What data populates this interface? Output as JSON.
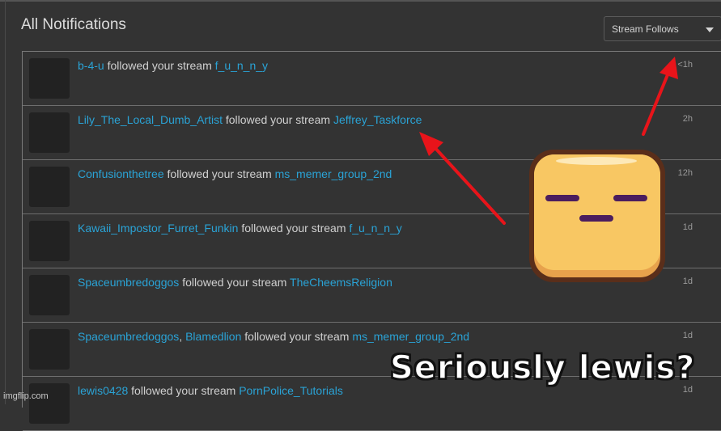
{
  "header": {
    "title": "All Notifications",
    "filter": {
      "selected": "Stream Follows"
    }
  },
  "colors": {
    "background": "#333333",
    "link": "#2aa3d6",
    "text": "#d0d0d0",
    "time": "#9a9a9a",
    "arrow": "#e8141a",
    "face": "#f8c763",
    "face_outline": "#5a2e1a",
    "face_features": "#4b1d5e"
  },
  "notifications": [
    {
      "users": [
        "b-4-u"
      ],
      "action": "followed your stream",
      "stream": "f_u_n_n_y",
      "time": "<1h"
    },
    {
      "users": [
        "Lily_The_Local_Dumb_Artist"
      ],
      "action": "followed your stream",
      "stream": "Jeffrey_Taskforce",
      "time": "2h"
    },
    {
      "users": [
        "Confusionthetree"
      ],
      "action": "followed your stream",
      "stream": "ms_memer_group_2nd",
      "time": "12h"
    },
    {
      "users": [
        "Kawaii_Impostor_Furret_Funkin"
      ],
      "action": "followed your stream",
      "stream": "f_u_n_n_y",
      "time": "1d"
    },
    {
      "users": [
        "Spaceumbredoggos"
      ],
      "action": "followed your stream",
      "stream": "TheCheemsReligion",
      "time": "1d"
    },
    {
      "users": [
        "Spaceumbredoggos",
        "Blamedlion"
      ],
      "action": "followed your stream",
      "stream": "ms_memer_group_2nd",
      "time": "1d"
    },
    {
      "users": [
        "lewis0428"
      ],
      "action": "followed your stream",
      "stream": "PornPolice_Tutorials",
      "time": "1d"
    }
  ],
  "meme": {
    "caption": "Seriously lewis?",
    "emoji": "expressionless-face-icon",
    "watermark": "imgflip.com"
  }
}
